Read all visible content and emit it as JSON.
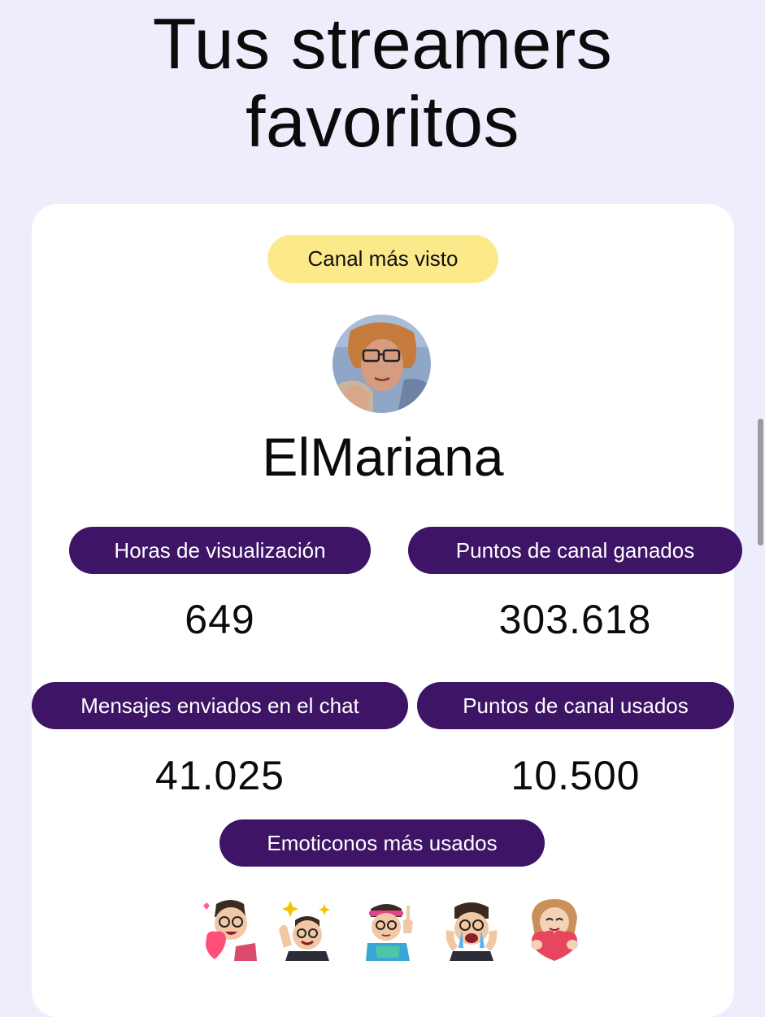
{
  "page": {
    "title_line1": "Tus streamers",
    "title_line2": "favoritos"
  },
  "card": {
    "badge": "Canal más visto",
    "streamer_name": "ElMariana",
    "stats": {
      "watch_hours": {
        "label": "Horas de visualización",
        "value": "649"
      },
      "points_earned": {
        "label": "Puntos de canal ganados",
        "value": "303.618"
      },
      "messages_sent": {
        "label": "Mensajes enviados en el chat",
        "value": "41.025"
      },
      "points_used": {
        "label": "Puntos de canal usados",
        "value": "10.500"
      }
    },
    "emotes_label": "Emoticonos más usados",
    "emotes": [
      "heart-love-emote",
      "sparkle-wave-emote",
      "headband-pointing-emote",
      "crying-emote",
      "heart-hug-emote"
    ]
  },
  "colors": {
    "background": "#eeedfc",
    "card": "#ffffff",
    "badge": "#fbe98a",
    "pill": "#3d1466"
  }
}
